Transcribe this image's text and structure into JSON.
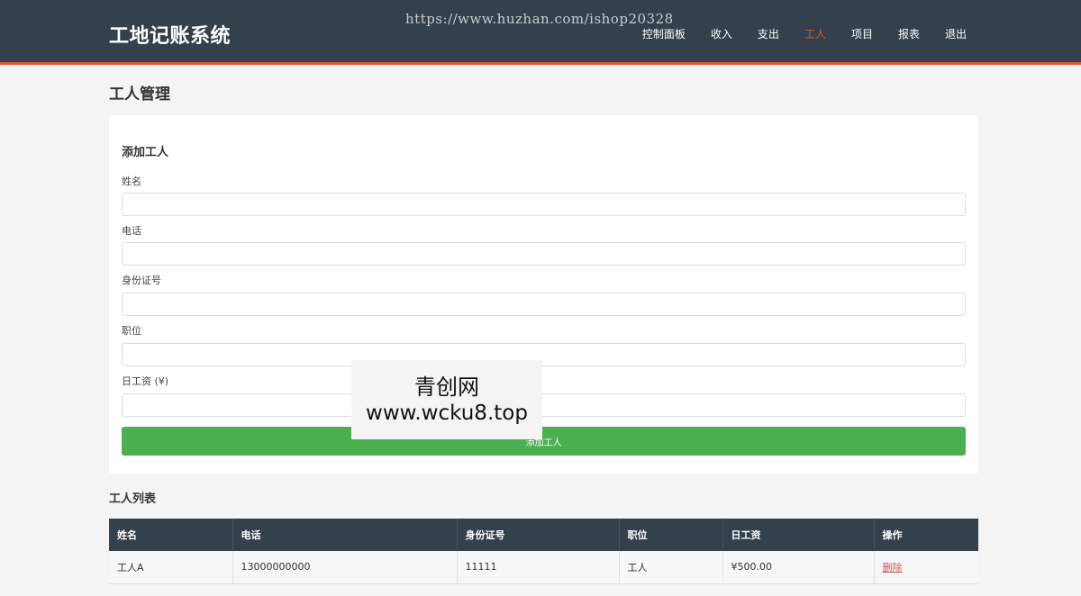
{
  "header": {
    "brand": "工地记账系统",
    "watermark_url": "https://www.huzhan.com/ishop20328",
    "nav": [
      {
        "label": "控制面板",
        "active": false
      },
      {
        "label": "收入",
        "active": false
      },
      {
        "label": "支出",
        "active": false
      },
      {
        "label": "工人",
        "active": true
      },
      {
        "label": "项目",
        "active": false
      },
      {
        "label": "报表",
        "active": false
      },
      {
        "label": "退出",
        "active": false
      }
    ]
  },
  "page_title": "工人管理",
  "form": {
    "title": "添加工人",
    "fields": [
      {
        "label": "姓名",
        "value": ""
      },
      {
        "label": "电话",
        "value": ""
      },
      {
        "label": "身份证号",
        "value": ""
      },
      {
        "label": "职位",
        "value": ""
      },
      {
        "label": "日工资 (¥)",
        "value": ""
      }
    ],
    "submit_label": "添加工人"
  },
  "overlay": {
    "name": "青创网",
    "url": "www.wcku8.top"
  },
  "list": {
    "title": "工人列表",
    "columns": [
      "姓名",
      "电话",
      "身份证号",
      "职位",
      "日工资",
      "操作"
    ],
    "rows": [
      {
        "name": "工人A",
        "phone": "13000000000",
        "id_number": "11111",
        "position": "工人",
        "wage": "¥500.00",
        "action": "删除"
      }
    ]
  },
  "colors": {
    "header_bg": "#34404b",
    "accent": "#e5562a",
    "button_green": "#4caf50",
    "delete_red": "#d9534f"
  }
}
